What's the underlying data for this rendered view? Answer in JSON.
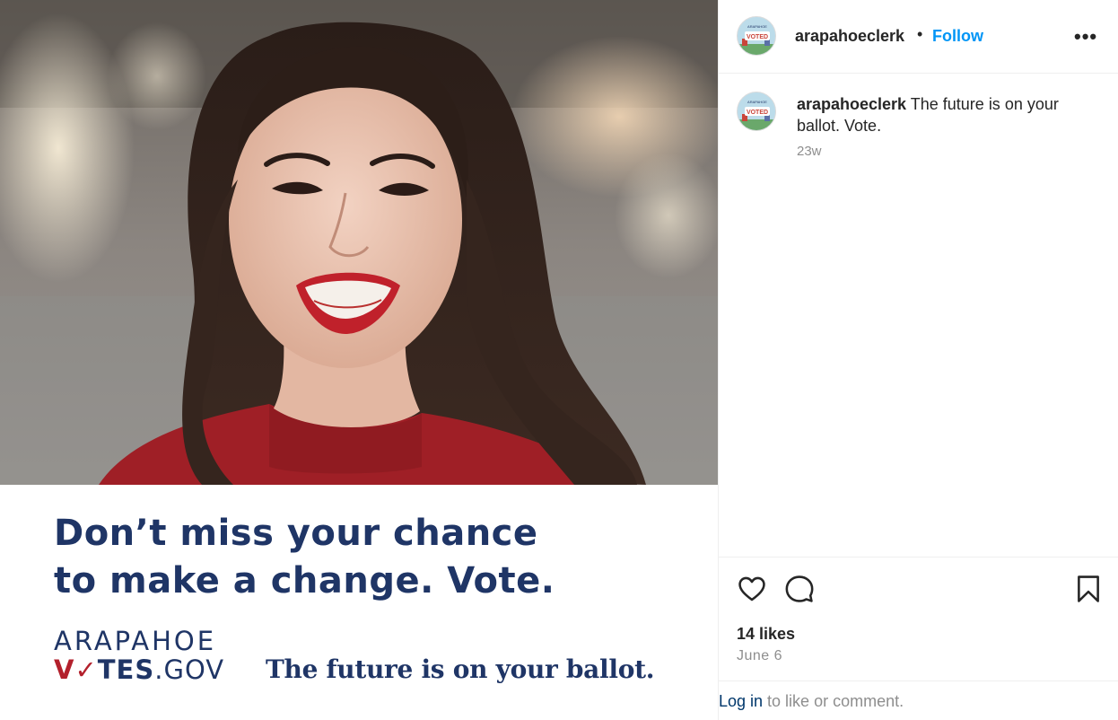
{
  "post": {
    "headline_line1": "Don’t miss your chance",
    "headline_line2": "to make a change. Vote.",
    "brand_top": "ARAPAHOE",
    "brand_v": "V",
    "brand_check": "✓",
    "brand_tes": "TES",
    "brand_gov": ".GOV",
    "tagline": "The future is on your ballot."
  },
  "header": {
    "username": "arapahoeclerk",
    "separator": "•",
    "follow_label": "Follow",
    "more_label": "•••",
    "avatar_text": "I VOTED"
  },
  "caption": {
    "username": "arapahoeclerk",
    "text": "The future is on your ballot. Vote.",
    "time": "23w"
  },
  "actions": {
    "likes": "14 likes",
    "date": "June 6"
  },
  "login": {
    "link_label": "Log in",
    "rest": " to like or comment."
  },
  "colors": {
    "brand_navy": "#1f3566",
    "brand_red": "#b3202c",
    "follow_blue": "#0095f6"
  },
  "icons": [
    "heart-icon",
    "comment-icon",
    "bookmark-icon",
    "more-icon"
  ]
}
